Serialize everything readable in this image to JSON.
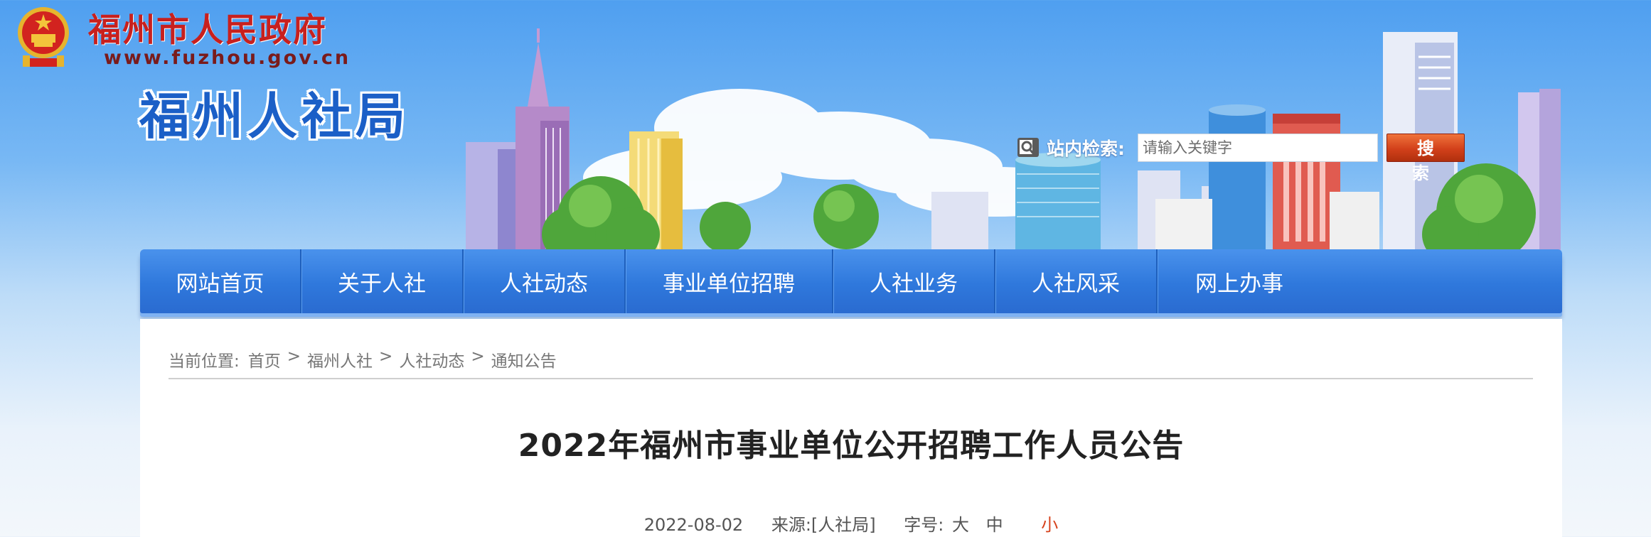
{
  "header": {
    "gov_name": "福州市人民政府",
    "gov_url": "www.fuzhou.gov.cn",
    "bureau_name": "福州人社局",
    "emblem_icon": "national-emblem-icon"
  },
  "search": {
    "label": "站内检索:",
    "placeholder": "请输入关键字",
    "button_label": "搜 索",
    "icon": "magnifier-icon"
  },
  "nav": {
    "items": [
      {
        "label": "网站首页"
      },
      {
        "label": "关于人社"
      },
      {
        "label": "人社动态"
      },
      {
        "label": "事业单位招聘"
      },
      {
        "label": "人社业务"
      },
      {
        "label": "人社风采"
      },
      {
        "label": "网上办事"
      }
    ]
  },
  "breadcrumb": {
    "prefix": "当前位置:",
    "items": [
      "首页",
      "福州人社",
      "人社动态",
      "通知公告"
    ],
    "separator": ">"
  },
  "article": {
    "title": "2022年福州市事业单位公开招聘工作人员公告",
    "date": "2022-08-02",
    "source": "来源:[人社局]",
    "font_size_label": "字号:",
    "font_sizes": [
      "大",
      "中",
      "小"
    ]
  },
  "colors": {
    "gov_red": "#c8201e",
    "bureau_blue": "#1b5fc7",
    "nav_blue": "#2f78dc",
    "button_orange": "#d2401a"
  }
}
